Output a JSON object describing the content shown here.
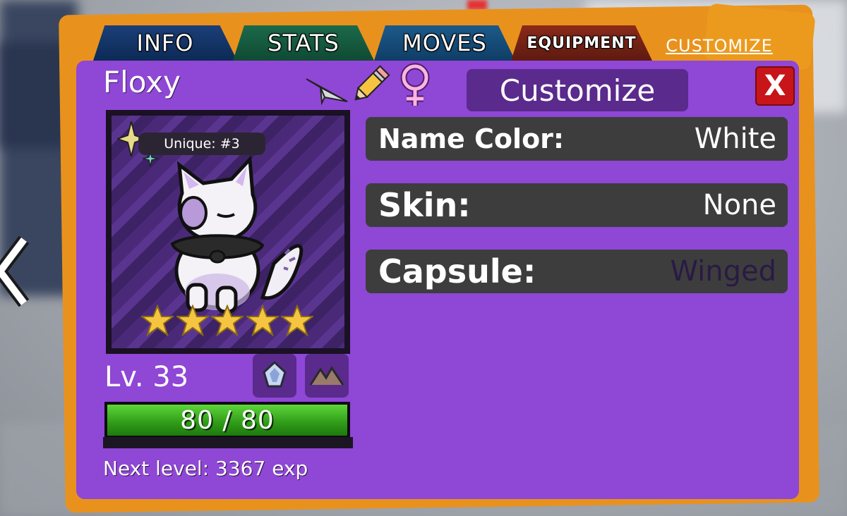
{
  "tabs": [
    {
      "label": "INFO"
    },
    {
      "label": "STATS"
    },
    {
      "label": "MOVES"
    },
    {
      "label": "EQUIPMENT"
    },
    {
      "label": "CUSTOMIZE",
      "active": true
    }
  ],
  "creature": {
    "name": "Floxy",
    "unique_label": "Unique: #3",
    "star_rating": 5,
    "level_text": "Lv. 33",
    "hp_text": "80 / 80",
    "hp_fraction": 1.0,
    "next_level_text": "Next level: 3367 exp",
    "header_icons": [
      "paper-plane-icon",
      "pencil-icon",
      "female-symbol-icon"
    ],
    "type_icons": [
      "crystal-type-icon",
      "mountain-type-icon"
    ]
  },
  "customize": {
    "title": "Customize",
    "close_label": "X",
    "rows": [
      {
        "label": "Name Color:",
        "value": "White"
      },
      {
        "label": "Skin:",
        "value": "None"
      },
      {
        "label": "Capsule:",
        "value": "Winged"
      }
    ]
  },
  "colors": {
    "panel": "#8f47d6",
    "orange_card": "#e8921d",
    "close_button": "#c7151a",
    "row_background": "#3d3d3d",
    "star": "#f5c542",
    "hp_fill": "#3fb321"
  }
}
